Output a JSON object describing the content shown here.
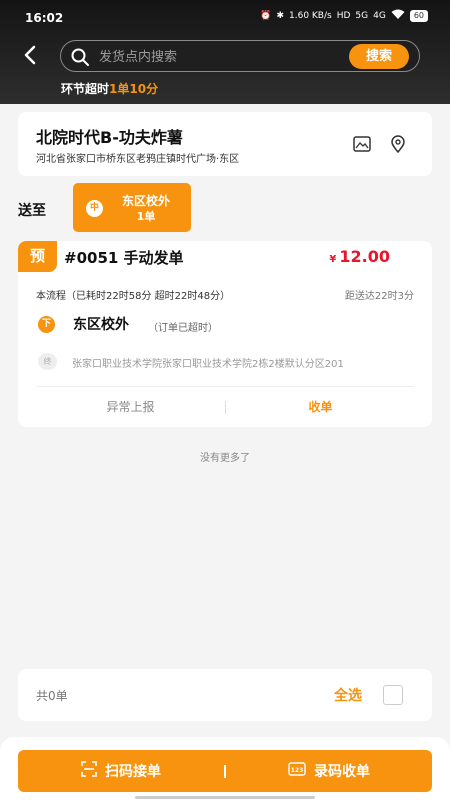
{
  "status_bar": {
    "time": "16:02",
    "network_speed": "1.60 KB/s",
    "hd_label": "HD",
    "signal_5g": "5G",
    "signal_4g": "4G",
    "battery": "60"
  },
  "header": {
    "search_placeholder": "发货点内搜索",
    "search_button": "搜索",
    "overtime_prefix": "环节超时",
    "overtime_value": "1单10分"
  },
  "store": {
    "name": "北院时代B-功夫炸薯",
    "address": "河北省张家口市桥东区老鸦庄镇时代广场·东区"
  },
  "send_to": {
    "label": "送至",
    "chip_badge": "中",
    "chip_name": "东区校外",
    "chip_count": "1单"
  },
  "order": {
    "badge": "预",
    "number": "#0051  手动发单",
    "currency": "¥",
    "price": "12.00",
    "flow_info": "本流程（已耗时22时58分 超时22时48分）",
    "distance_info": "距送达22时3分",
    "dest_badge": "下",
    "dest_name": "东区校外",
    "dest_note": "（订单已超时）",
    "end_badge": "终",
    "end_address": "张家口职业技术学院张家口职业技术学院2栋2楼默认分区201",
    "exception_label": "异常上报",
    "receive_label": "收单"
  },
  "list_footer": "没有更多了",
  "select_bar": {
    "total": "共0单",
    "select_all": "全选"
  },
  "actions": {
    "scan_label": "扫码接单",
    "code_label": "录码收单",
    "code_icon_text": "123"
  },
  "colors": {
    "accent": "#f7930e",
    "price": "#e8152a",
    "header_dark": "#1a1a1a"
  }
}
